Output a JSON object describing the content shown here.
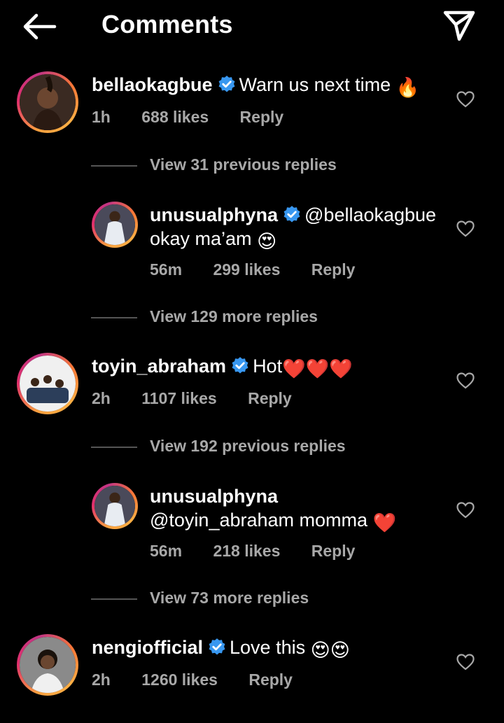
{
  "header": {
    "title": "Comments",
    "back_icon": "arrow-left-icon",
    "share_icon": "send-icon"
  },
  "comments": [
    {
      "username": "bellaokagbue",
      "verified": true,
      "text": "Warn us next time",
      "emoji": "🔥",
      "time": "1h",
      "likes": "688 likes",
      "reply": "Reply",
      "view_replies": "View 31 previous replies",
      "reply_item": {
        "username": "unusualphyna",
        "verified": true,
        "text_line1": "@bellaokagbue",
        "text_line2": "okay ma’am",
        "emoji": "😍",
        "time": "56m",
        "likes": "299 likes",
        "reply": "Reply"
      },
      "view_more": "View 129 more replies"
    },
    {
      "username": "toyin_abraham",
      "verified": true,
      "text": "Hot",
      "emoji": "❤️❤️❤️",
      "time": "2h",
      "likes": "1107 likes",
      "reply": "Reply",
      "view_replies": "View 192 previous replies",
      "reply_item": {
        "username": "unusualphyna",
        "verified": false,
        "text_line1": "",
        "text_line2": "@toyin_abraham momma",
        "emoji": "❤️",
        "time": "56m",
        "likes": "218 likes",
        "reply": "Reply"
      },
      "view_more": "View 73 more replies"
    },
    {
      "username": "nengiofficial",
      "verified": true,
      "text": "Love this",
      "emoji": "😍😍",
      "time": "2h",
      "likes": "1260 likes",
      "reply": "Reply"
    }
  ],
  "colors": {
    "background": "#000000",
    "muted": "#a8a8a8",
    "verified": "#3897f0",
    "heart_red": "#ed1c24"
  }
}
